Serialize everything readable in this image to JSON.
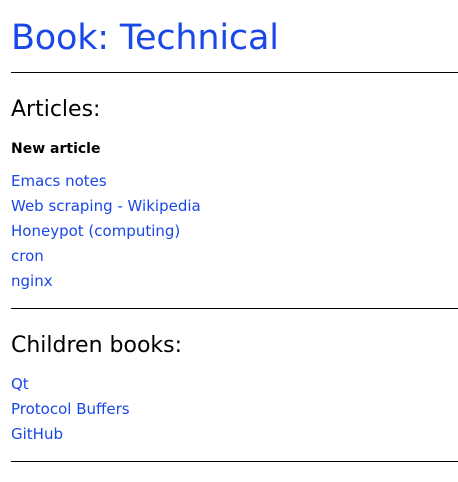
{
  "page": {
    "title": "Book: Technical"
  },
  "articles": {
    "heading": "Articles:",
    "new_article_label": "New article",
    "items": [
      "Emacs notes",
      "Web scraping - Wikipedia",
      "Honeypot (computing)",
      "cron",
      "nginx"
    ]
  },
  "children": {
    "heading": "Children books:",
    "items": [
      "Qt",
      "Protocol Buffers",
      "GitHub"
    ]
  },
  "colors": {
    "link": "#1a47e8",
    "title": "#1a47e8",
    "text": "#000000",
    "background": "#ffffff"
  }
}
